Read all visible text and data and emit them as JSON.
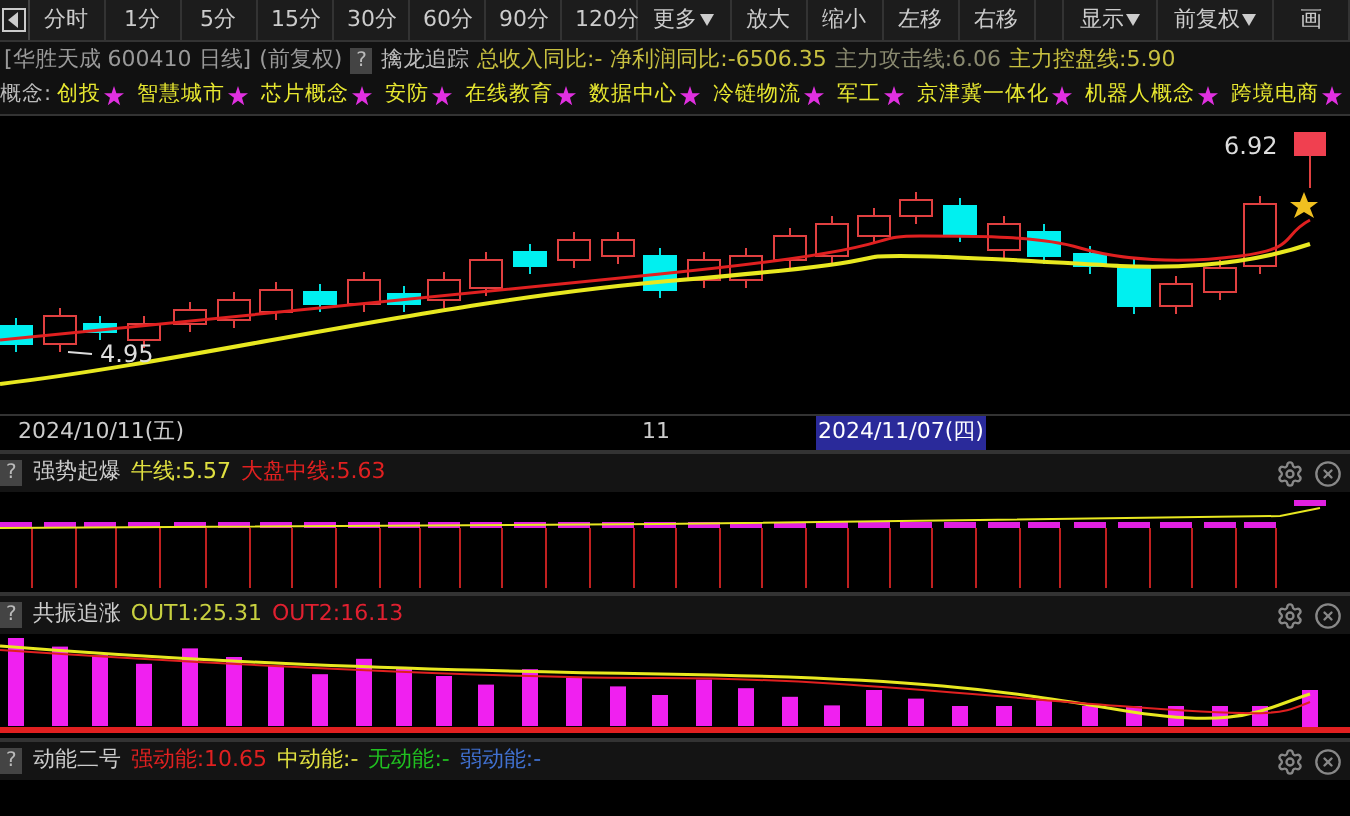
{
  "toolbar": {
    "buttons": [
      {
        "label": "分时",
        "kind": "plain"
      },
      {
        "label": "1分",
        "kind": "plain"
      },
      {
        "label": "5分",
        "kind": "plain"
      },
      {
        "label": "15分",
        "kind": "plain"
      },
      {
        "label": "30分",
        "kind": "plain"
      },
      {
        "label": "60分",
        "kind": "plain"
      },
      {
        "label": "90分",
        "kind": "plain"
      },
      {
        "label": "120分",
        "kind": "plain"
      },
      {
        "label": "更多",
        "kind": "menu"
      },
      {
        "label": "放大",
        "kind": "plain"
      },
      {
        "label": "缩小",
        "kind": "plain"
      },
      {
        "label": "左移",
        "kind": "plain"
      },
      {
        "label": "右移",
        "kind": "plain"
      },
      {
        "kind": "spacer"
      },
      {
        "label": "显示",
        "kind": "menu"
      },
      {
        "label": "前复权",
        "kind": "menu"
      },
      {
        "label": "画",
        "kind": "plain"
      }
    ]
  },
  "info": {
    "title": "[华胜天成 600410 日线]",
    "adjust": "(前复权)",
    "help": "?",
    "indicator": "擒龙追踪",
    "values": [
      {
        "text": "总收入同比:-",
        "color": "#c8c040"
      },
      {
        "text": "净利润同比:-6506.35",
        "color": "#c8c040"
      },
      {
        "text": "主力攻击线:6.06",
        "color": "#8a8a70"
      },
      {
        "text": "主力控盘线:5.90",
        "color": "#c8c040"
      }
    ]
  },
  "concepts": {
    "label": "概念:",
    "items": [
      "创投",
      "智慧城市",
      "芯片概念",
      "安防",
      "在线教育",
      "数据中心",
      "冷链物流",
      "军工",
      "京津冀一体化",
      "机器人概念",
      "跨境电商"
    ]
  },
  "main_chart": {
    "high_label": "6.92",
    "low_label": "4.95"
  },
  "date_axis": [
    {
      "text": "2024/10/11(五)",
      "selected": false
    },
    {
      "text": "11",
      "selected": false
    },
    {
      "text": "2024/11/07(四)",
      "selected": true
    }
  ],
  "indicators": [
    {
      "help": "?",
      "name": "强势起爆",
      "kind": "burst",
      "values": [
        {
          "text": "牛线:5.57",
          "color": "#e0e040"
        },
        {
          "text": "大盘中线:5.63",
          "color": "#e02020"
        }
      ]
    },
    {
      "help": "?",
      "name": "共振追涨",
      "kind": "resonance",
      "values": [
        {
          "text": "OUT1:25.31",
          "color": "#c8d040"
        },
        {
          "text": "OUT2:16.13",
          "color": "#e02030"
        }
      ]
    },
    {
      "help": "?",
      "name": "动能二号",
      "kind": "momentum",
      "values": [
        {
          "text": "强动能:10.65",
          "color": "#e02020"
        },
        {
          "text": "中动能:-",
          "color": "#e0e040"
        },
        {
          "text": "无动能:-",
          "color": "#20c020"
        },
        {
          "text": "弱动能:-",
          "color": "#4070d0"
        }
      ]
    }
  ]
}
